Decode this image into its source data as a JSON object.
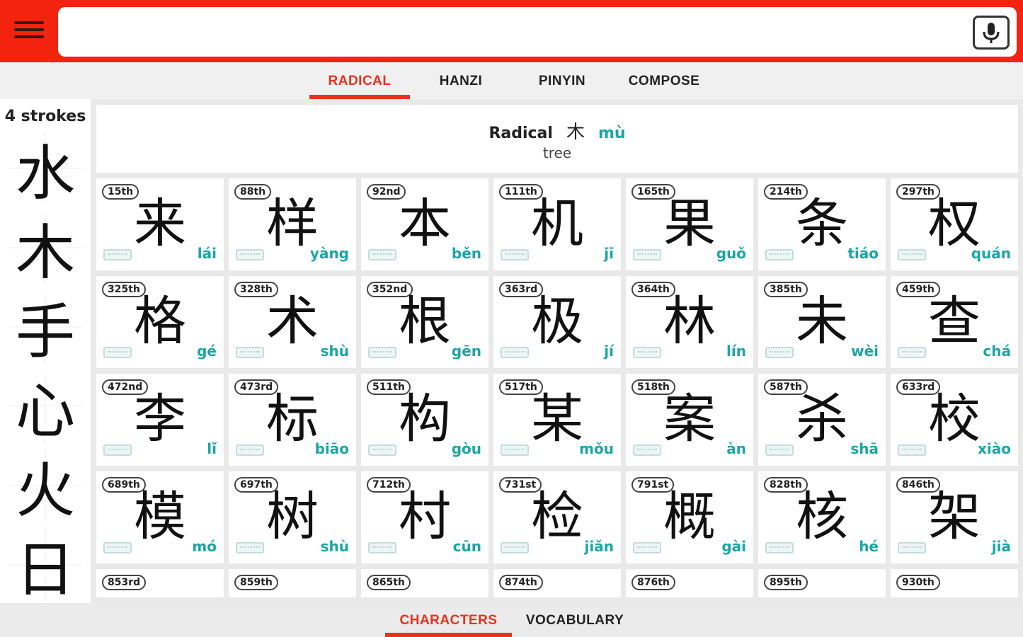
{
  "colors": {
    "brand_red": "#f4230f",
    "accent_red": "#e8321d",
    "pinyin_teal": "#1aa6a6"
  },
  "search": {
    "value": "",
    "placeholder": ""
  },
  "tabs": [
    {
      "label": "RADICAL",
      "active": true
    },
    {
      "label": "HANZI",
      "active": false
    },
    {
      "label": "PINYIN",
      "active": false
    },
    {
      "label": "COMPOSE",
      "active": false
    }
  ],
  "strokes_panel": {
    "title": "4 strokes",
    "radicals": [
      "水",
      "木",
      "手",
      "心",
      "火",
      "日"
    ]
  },
  "radical_header": {
    "label": "Radical",
    "char": "木",
    "pinyin": "mù",
    "meaning": "tree"
  },
  "characters": [
    {
      "rank": "15th",
      "hanzi": "来",
      "pinyin": "lái"
    },
    {
      "rank": "88th",
      "hanzi": "样",
      "pinyin": "yàng"
    },
    {
      "rank": "92nd",
      "hanzi": "本",
      "pinyin": "běn"
    },
    {
      "rank": "111th",
      "hanzi": "机",
      "pinyin": "jī"
    },
    {
      "rank": "165th",
      "hanzi": "果",
      "pinyin": "guǒ"
    },
    {
      "rank": "214th",
      "hanzi": "条",
      "pinyin": "tiáo"
    },
    {
      "rank": "297th",
      "hanzi": "权",
      "pinyin": "quán"
    },
    {
      "rank": "325th",
      "hanzi": "格",
      "pinyin": "gé"
    },
    {
      "rank": "328th",
      "hanzi": "术",
      "pinyin": "shù"
    },
    {
      "rank": "352nd",
      "hanzi": "根",
      "pinyin": "gēn"
    },
    {
      "rank": "363rd",
      "hanzi": "极",
      "pinyin": "jí"
    },
    {
      "rank": "364th",
      "hanzi": "林",
      "pinyin": "lín"
    },
    {
      "rank": "385th",
      "hanzi": "未",
      "pinyin": "wèi"
    },
    {
      "rank": "459th",
      "hanzi": "查",
      "pinyin": "chá"
    },
    {
      "rank": "472nd",
      "hanzi": "李",
      "pinyin": "lǐ"
    },
    {
      "rank": "473rd",
      "hanzi": "标",
      "pinyin": "biāo"
    },
    {
      "rank": "511th",
      "hanzi": "构",
      "pinyin": "gòu"
    },
    {
      "rank": "517th",
      "hanzi": "某",
      "pinyin": "mǒu"
    },
    {
      "rank": "518th",
      "hanzi": "案",
      "pinyin": "àn"
    },
    {
      "rank": "587th",
      "hanzi": "杀",
      "pinyin": "shā"
    },
    {
      "rank": "633rd",
      "hanzi": "校",
      "pinyin": "xiào"
    },
    {
      "rank": "689th",
      "hanzi": "模",
      "pinyin": "mó"
    },
    {
      "rank": "697th",
      "hanzi": "树",
      "pinyin": "shù"
    },
    {
      "rank": "712th",
      "hanzi": "村",
      "pinyin": "cūn"
    },
    {
      "rank": "731st",
      "hanzi": "检",
      "pinyin": "jiǎn"
    },
    {
      "rank": "791st",
      "hanzi": "概",
      "pinyin": "gài"
    },
    {
      "rank": "828th",
      "hanzi": "核",
      "pinyin": "hé"
    },
    {
      "rank": "846th",
      "hanzi": "架",
      "pinyin": "jià"
    },
    {
      "rank": "853rd",
      "hanzi": "",
      "pinyin": ""
    },
    {
      "rank": "859th",
      "hanzi": "",
      "pinyin": ""
    },
    {
      "rank": "865th",
      "hanzi": "",
      "pinyin": ""
    },
    {
      "rank": "874th",
      "hanzi": "",
      "pinyin": ""
    },
    {
      "rank": "876th",
      "hanzi": "",
      "pinyin": ""
    },
    {
      "rank": "895th",
      "hanzi": "",
      "pinyin": ""
    },
    {
      "rank": "930th",
      "hanzi": "",
      "pinyin": ""
    }
  ],
  "bottom_tabs": [
    {
      "label": "CHARACTERS",
      "active": true
    },
    {
      "label": "VOCABULARY",
      "active": false
    }
  ]
}
